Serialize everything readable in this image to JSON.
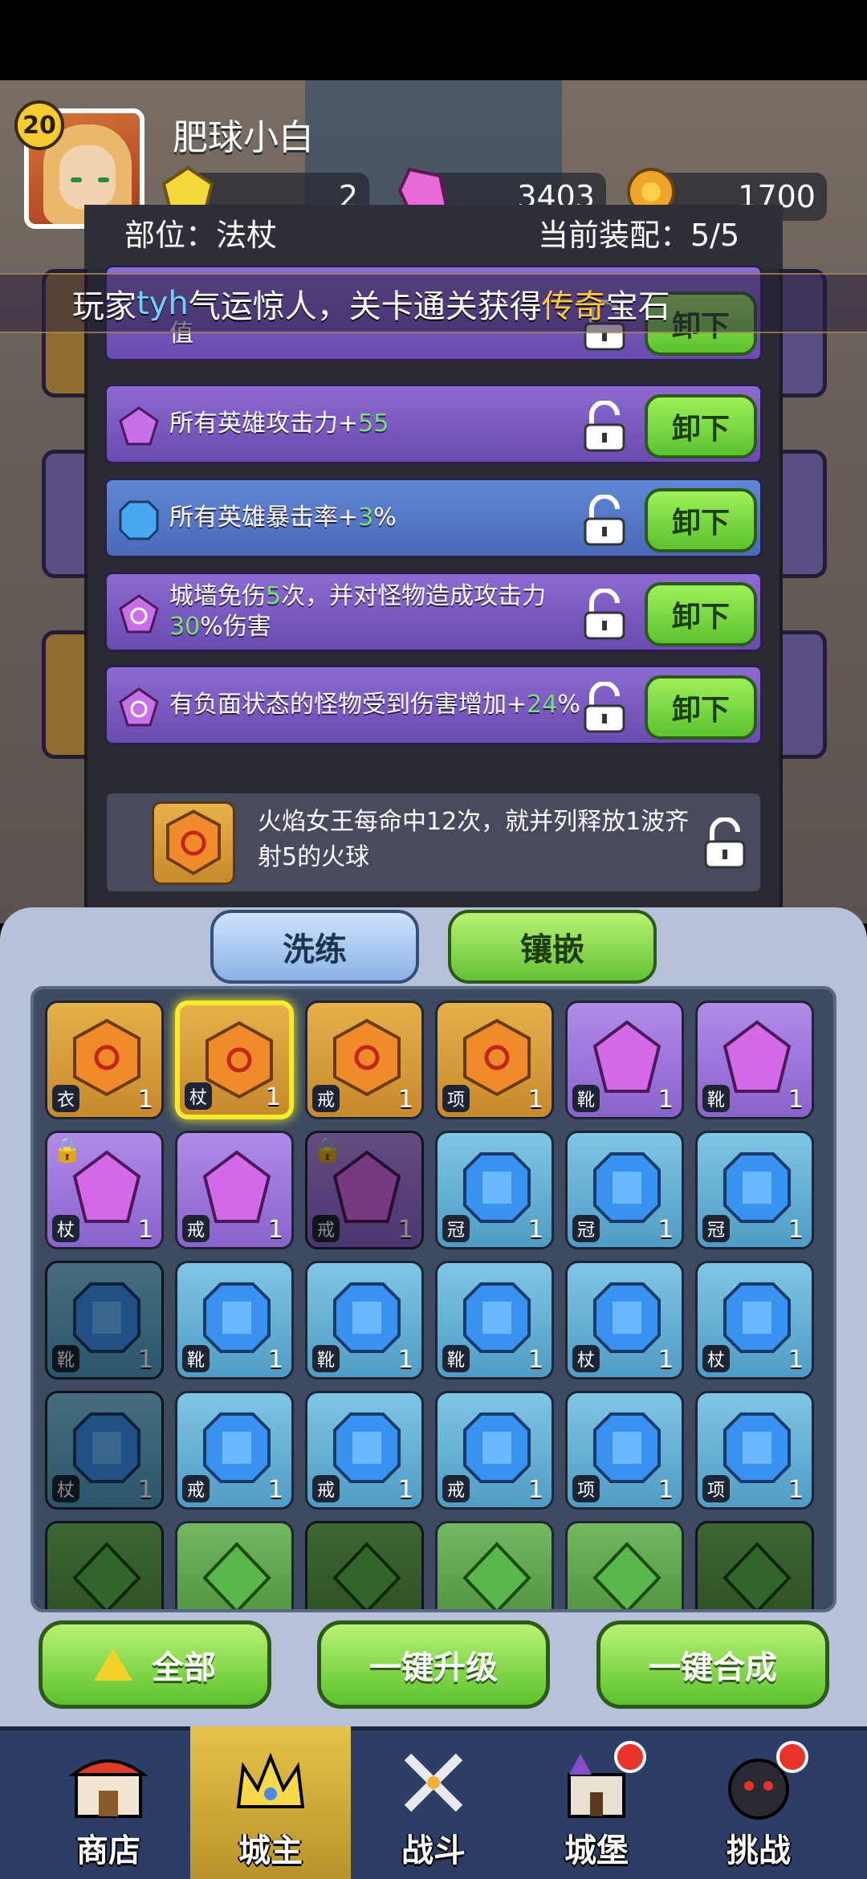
{
  "player": {
    "level": "20",
    "name": "肥球小白"
  },
  "currencies": [
    {
      "icon": "gold-gem-icon",
      "value": "2"
    },
    {
      "icon": "pink-gem-icon",
      "value": "3403"
    },
    {
      "icon": "coin-icon",
      "value": "1700"
    }
  ],
  "modal": {
    "slot_label": "部位：法杖",
    "equipped_label": "当前装配：5/5"
  },
  "broadcast": {
    "prefix": "玩家",
    "player": "tyh",
    "middle": "气运惊人，关卡通关获得",
    "highlight": "传奇",
    "suffix": "宝石"
  },
  "affixes": [
    {
      "color": "purple",
      "text": "值",
      "button": "卸下"
    },
    {
      "color": "purple",
      "text_pre": "所有英雄攻击力+",
      "value": "55",
      "text_post": "",
      "button": "卸下"
    },
    {
      "color": "blue",
      "text_pre": "所有英雄暴击率+",
      "value": "3",
      "text_post": "%",
      "button": "卸下"
    },
    {
      "color": "purple",
      "text_pre": "城墙免伤",
      "value": "5",
      "text_mid": "次，并对怪物造成攻击力",
      "value2": "30",
      "text_post": "%伤害",
      "button": "卸下"
    },
    {
      "color": "purple",
      "text_pre": "有负面状态的怪物受到伤害增加+",
      "value": "24",
      "text_post": "%",
      "button": "卸下"
    }
  ],
  "set_bonus": {
    "text": "火焰女王每命中12次，就并列释放1波齐射5的火球"
  },
  "actions": {
    "refine": "洗练",
    "inlay": "镶嵌"
  },
  "inventory": {
    "rows": [
      [
        {
          "c": "gold",
          "n": "1",
          "t": "衣"
        },
        {
          "c": "gold",
          "n": "1",
          "t": "杖",
          "sel": true
        },
        {
          "c": "gold",
          "n": "1",
          "t": "戒"
        },
        {
          "c": "gold",
          "n": "1",
          "t": "项"
        },
        {
          "c": "purple",
          "n": "1",
          "t": "靴"
        },
        {
          "c": "purple",
          "n": "1",
          "t": "靴"
        }
      ],
      [
        {
          "c": "purple",
          "n": "1",
          "t": "杖",
          "lock": true
        },
        {
          "c": "purple",
          "n": "1",
          "t": "戒"
        },
        {
          "c": "purple",
          "n": "1",
          "t": "戒",
          "lock": true,
          "dim": true
        },
        {
          "c": "blue",
          "n": "1",
          "t": "冠"
        },
        {
          "c": "blue",
          "n": "1",
          "t": "冠"
        },
        {
          "c": "blue",
          "n": "1",
          "t": "冠"
        }
      ],
      [
        {
          "c": "blue",
          "n": "1",
          "t": "靴",
          "dim": true
        },
        {
          "c": "blue",
          "n": "1",
          "t": "靴"
        },
        {
          "c": "blue",
          "n": "1",
          "t": "靴"
        },
        {
          "c": "blue",
          "n": "1",
          "t": "靴"
        },
        {
          "c": "blue",
          "n": "1",
          "t": "杖"
        },
        {
          "c": "blue",
          "n": "1",
          "t": "杖"
        }
      ],
      [
        {
          "c": "blue",
          "n": "1",
          "t": "杖",
          "dim": true
        },
        {
          "c": "blue",
          "n": "1",
          "t": "戒"
        },
        {
          "c": "blue",
          "n": "1",
          "t": "戒"
        },
        {
          "c": "blue",
          "n": "1",
          "t": "戒"
        },
        {
          "c": "blue",
          "n": "1",
          "t": "项"
        },
        {
          "c": "blue",
          "n": "1",
          "t": "项"
        }
      ],
      [
        {
          "c": "green",
          "n": "",
          "t": "",
          "dim": true
        },
        {
          "c": "green",
          "n": "",
          "t": ""
        },
        {
          "c": "green",
          "n": "",
          "t": "",
          "dim": true
        },
        {
          "c": "green",
          "n": "",
          "t": ""
        },
        {
          "c": "green",
          "n": "",
          "t": ""
        },
        {
          "c": "green",
          "n": "",
          "t": "",
          "dim": true
        }
      ]
    ]
  },
  "bottom_buttons": {
    "all": "全部",
    "upgrade": "一键升级",
    "merge": "一键合成"
  },
  "nav": [
    {
      "label": "商店",
      "icon": "shop-icon"
    },
    {
      "label": "城主",
      "icon": "crown-icon"
    },
    {
      "label": "战斗",
      "icon": "swords-icon"
    },
    {
      "label": "城堡",
      "icon": "castle-icon"
    },
    {
      "label": "挑战",
      "icon": "bomb-icon"
    }
  ],
  "colors": {
    "accent_green": "#5cc22e",
    "affix_purple": "#7a5ac4",
    "affix_blue": "#5a7ac8",
    "value_green": "#7be07a",
    "legend_gold": "#ffc93a"
  }
}
